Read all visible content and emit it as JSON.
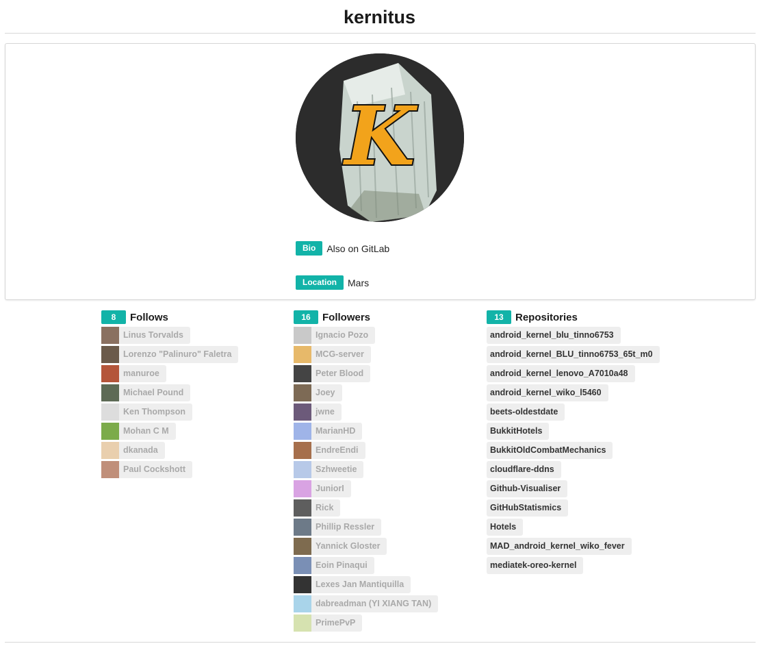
{
  "profile": {
    "username": "kernitus",
    "avatar_letter": "K",
    "bio_label": "Bio",
    "bio": "Also on GitLab",
    "location_label": "Location",
    "location": "Mars"
  },
  "colors": {
    "accent": "#12b3a8",
    "chip_bg": "#eeeeee",
    "muted_text": "#a9a9a9"
  },
  "follows": {
    "count": "8",
    "title": "Follows",
    "users": [
      {
        "name": "Linus Torvalds",
        "avatar": "photo-icon",
        "color": "#8a7060"
      },
      {
        "name": "Lorenzo \"Palinuro\" Faletra",
        "avatar": "photo-icon",
        "color": "#6b5a4a"
      },
      {
        "name": "manuroe",
        "avatar": "photo-icon",
        "color": "#b4553a"
      },
      {
        "name": "Michael Pound",
        "avatar": "photo-icon",
        "color": "#5d6a55"
      },
      {
        "name": "Ken Thompson",
        "avatar": "sketch-icon",
        "color": "#dddddd"
      },
      {
        "name": "Mohan C M",
        "avatar": "android-icon",
        "color": "#7cab4a"
      },
      {
        "name": "dkanada",
        "avatar": "identicon-icon",
        "color": "#e9cfae"
      },
      {
        "name": "Paul Cockshott",
        "avatar": "photo-icon",
        "color": "#c08f7a"
      }
    ]
  },
  "followers": {
    "count": "16",
    "title": "Followers",
    "users": [
      {
        "name": "Ignacio Pozo",
        "avatar": "photo-icon",
        "color": "#c9c9c9"
      },
      {
        "name": "MCG-server",
        "avatar": "identicon-icon",
        "color": "#e7b96a"
      },
      {
        "name": "Peter Blood",
        "avatar": "logo-icon",
        "color": "#444444"
      },
      {
        "name": "Joey",
        "avatar": "photo-icon",
        "color": "#7d6a55"
      },
      {
        "name": "jwne",
        "avatar": "photo-icon",
        "color": "#6c5a7a"
      },
      {
        "name": "MarianHD",
        "avatar": "identicon-icon",
        "color": "#9fb4e8"
      },
      {
        "name": "EndreEndi",
        "avatar": "photo-icon",
        "color": "#a66f4c"
      },
      {
        "name": "Szhweetie",
        "avatar": "line-icon",
        "color": "#b7c9e8"
      },
      {
        "name": "JuniorI",
        "avatar": "identicon-icon",
        "color": "#d9a3e3"
      },
      {
        "name": "Rick",
        "avatar": "photo-icon",
        "color": "#5e5e5e"
      },
      {
        "name": "Phillip Ressler",
        "avatar": "photo-icon",
        "color": "#6d7a88"
      },
      {
        "name": "Yannick Gloster",
        "avatar": "photo-icon",
        "color": "#7e6b4f"
      },
      {
        "name": "Eoin Pinaqui",
        "avatar": "photo-icon",
        "color": "#7a8fb5"
      },
      {
        "name": "Lexes Jan Mantiquilla",
        "avatar": "photo-icon",
        "color": "#333333"
      },
      {
        "name": "dabreadman (YI XIANG TAN)",
        "avatar": "identicon-icon",
        "color": "#a9d4ea"
      },
      {
        "name": "PrimePvP",
        "avatar": "identicon-icon",
        "color": "#d6e2b0"
      }
    ]
  },
  "repositories": {
    "count": "13",
    "title": "Repositories",
    "items": [
      "android_kernel_blu_tinno6753",
      "android_kernel_BLU_tinno6753_65t_m0",
      "android_kernel_lenovo_A7010a48",
      "android_kernel_wiko_l5460",
      "beets-oldestdate",
      "BukkitHotels",
      "BukkitOldCombatMechanics",
      "cloudflare-ddns",
      "Github-Visualiser",
      "GitHubStatismics",
      "Hotels",
      "MAD_android_kernel_wiko_fever",
      "mediatek-oreo-kernel"
    ]
  }
}
